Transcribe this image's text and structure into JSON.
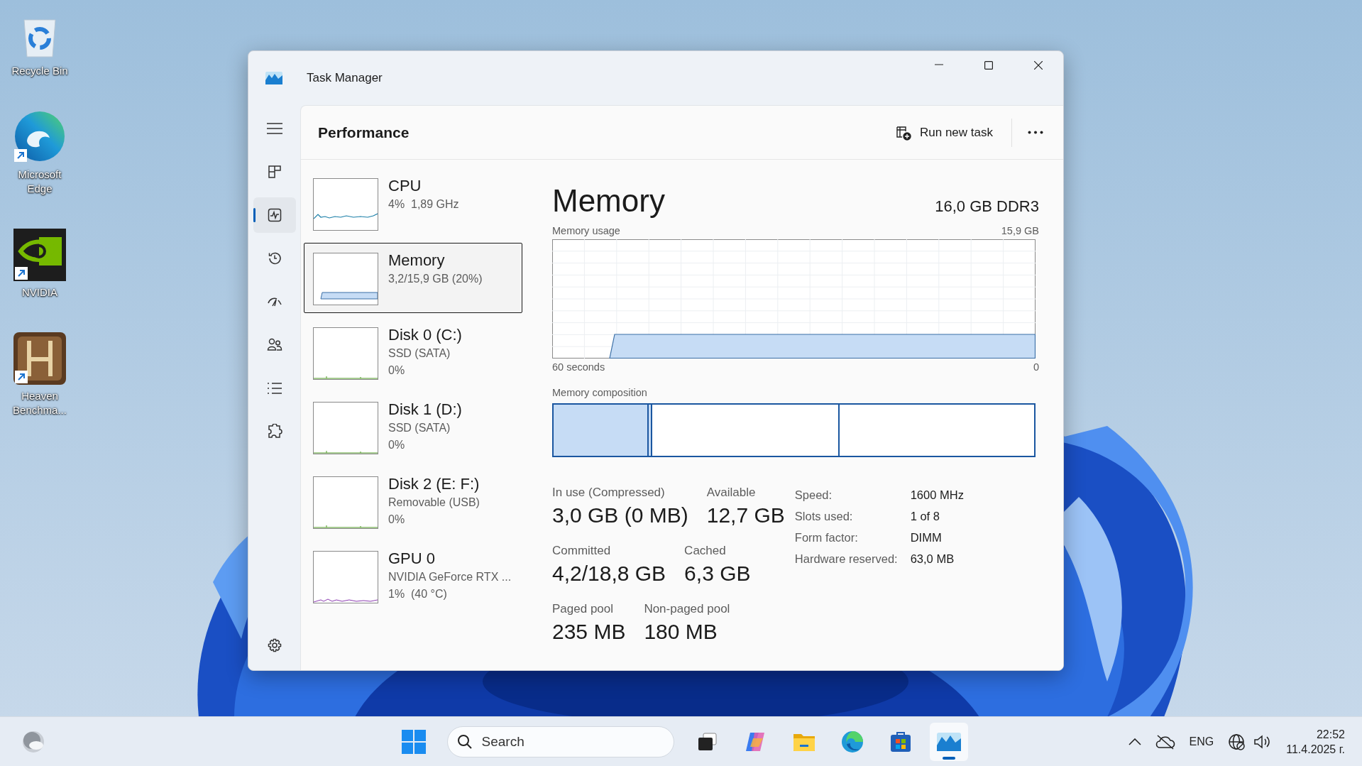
{
  "desktop_icons": [
    {
      "kind": "recycle-bin",
      "label": "Recycle Bin",
      "shortcut": false
    },
    {
      "kind": "edge",
      "label": "Microsoft Edge",
      "shortcut": true
    },
    {
      "kind": "nvidia",
      "label": "NVIDIA",
      "shortcut": true
    },
    {
      "kind": "heaven",
      "label": "Heaven Benchma...",
      "shortcut": true
    }
  ],
  "window": {
    "title": "Task Manager",
    "page_title": "Performance",
    "run_task_label": "Run new task"
  },
  "nav": [
    {
      "kind": "processes",
      "selected": false
    },
    {
      "kind": "performance",
      "selected": true
    },
    {
      "kind": "app-history",
      "selected": false
    },
    {
      "kind": "startup",
      "selected": false
    },
    {
      "kind": "users",
      "selected": false
    },
    {
      "kind": "details",
      "selected": false
    },
    {
      "kind": "services",
      "selected": false
    }
  ],
  "perf_items": [
    {
      "kind": "cpu",
      "name": "CPU",
      "lines": [
        "4%  1,89 GHz"
      ],
      "selected": false
    },
    {
      "kind": "memory",
      "name": "Memory",
      "lines": [
        "3,2/15,9 GB (20%)"
      ],
      "selected": true
    },
    {
      "kind": "disk",
      "name": "Disk 0 (C:)",
      "lines": [
        "SSD (SATA)",
        "0%"
      ],
      "selected": false
    },
    {
      "kind": "disk",
      "name": "Disk 1 (D:)",
      "lines": [
        "SSD (SATA)",
        "0%"
      ],
      "selected": false
    },
    {
      "kind": "disk",
      "name": "Disk 2 (E: F:)",
      "lines": [
        "Removable (USB)",
        "0%"
      ],
      "selected": false
    },
    {
      "kind": "gpu",
      "name": "GPU 0",
      "lines": [
        "NVIDIA GeForce RTX ...",
        "1%  (40 °C)"
      ],
      "selected": false
    }
  ],
  "detail": {
    "title": "Memory",
    "spec": "16,0 GB DDR3",
    "usage_chart": {
      "label": "Memory usage",
      "max_label": "15,9 GB",
      "left_label": "60 seconds",
      "right_label": "0"
    },
    "composition": {
      "label": "Memory composition",
      "segments": [
        {
          "kind": "in-use",
          "level": 0.195
        },
        {
          "kind": "modified",
          "level": 0.01
        },
        {
          "kind": "standby",
          "level": 0.39
        },
        {
          "kind": "free",
          "level": 0.405
        }
      ]
    },
    "stat_rows": [
      {
        "items": [
          {
            "label": "In use (Compressed)",
            "value": "3,0 GB (0 MB)"
          },
          {
            "label": "Available",
            "value": "12,7 GB"
          }
        ]
      },
      {
        "items": [
          {
            "label": "Committed",
            "value": "4,2/18,8 GB"
          },
          {
            "label": "Cached",
            "value": "6,3 GB"
          }
        ]
      },
      {
        "items": [
          {
            "label": "Paged pool",
            "value": "235 MB"
          },
          {
            "label": "Non-paged pool",
            "value": "180 MB"
          }
        ]
      }
    ],
    "specs": [
      {
        "label": "Speed:",
        "value": "1600 MHz"
      },
      {
        "label": "Slots used:",
        "value": "1 of 8"
      },
      {
        "label": "Form factor:",
        "value": "DIMM"
      },
      {
        "label": "Hardware reserved:",
        "value": "63,0 MB"
      }
    ]
  },
  "taskbar": {
    "search_placeholder": "Search",
    "apps": [
      {
        "kind": "task-view",
        "active": false
      },
      {
        "kind": "copilot",
        "active": false
      },
      {
        "kind": "explorer",
        "active": false
      },
      {
        "kind": "edge",
        "active": false
      },
      {
        "kind": "store",
        "active": false
      },
      {
        "kind": "task-manager",
        "active": true
      }
    ],
    "language": "ENG",
    "time": "22:52",
    "date": "11.4.2025 г."
  }
}
